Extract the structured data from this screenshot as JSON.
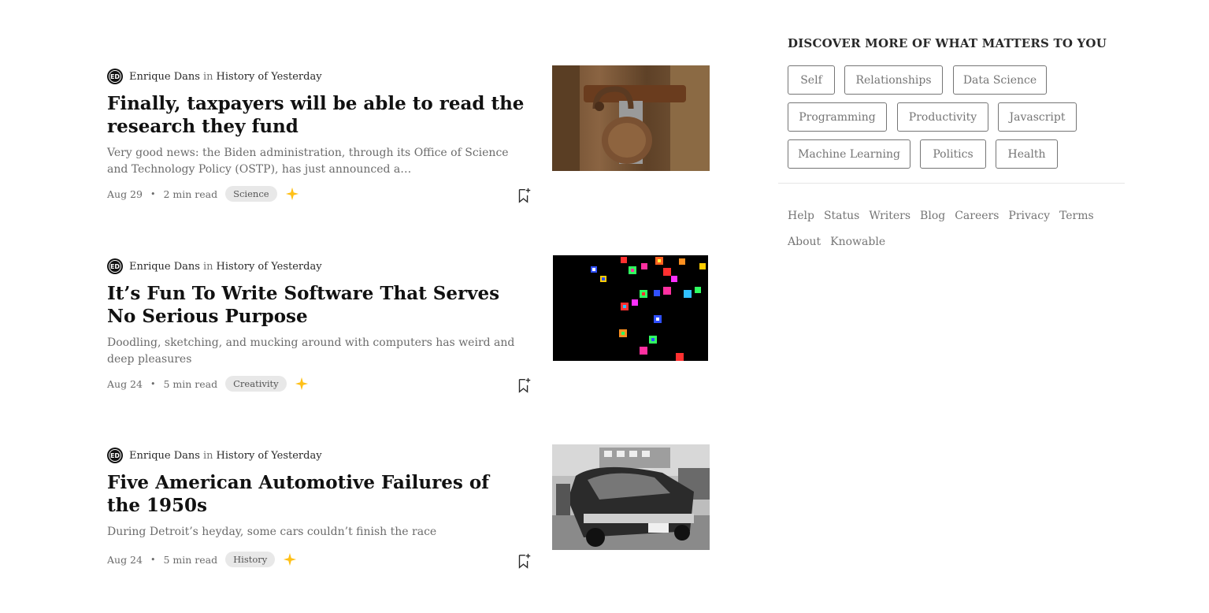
{
  "articles": [
    {
      "author": "Enrique Dans",
      "in": "in",
      "publication": "History of Yesterday",
      "title": "Finally, taxpayers will be able to read the research they fund",
      "subtitle": "Very good news: the Biden administration, through its Office of Science and Technology Policy (OSTP), has just announced a…",
      "date": "Aug 29",
      "read_time": "2 min read",
      "tag": "Science",
      "image": "rusty-padlock-photo"
    },
    {
      "author": "Enrique Dans",
      "in": "in",
      "publication": "History of Yesterday",
      "title": "It’s Fun To Write Software That Serves No Serious Purpose",
      "subtitle": "Doodling, sketching, and mucking around with computers has weird and deep pleasures",
      "date": "Aug 24",
      "read_time": "5 min read",
      "tag": "Creativity",
      "image": "pixel-art-on-black"
    },
    {
      "author": "Enrique Dans",
      "in": "in",
      "publication": "History of Yesterday",
      "title": "Five American Automotive Failures of the 1950s",
      "subtitle": "During Detroit’s heyday, some cars couldn’t finish the race",
      "date": "Aug 24",
      "read_time": "5 min read",
      "tag": "History",
      "image": "wrecked-1950s-car-photo"
    }
  ],
  "avatar_text": "ED",
  "bullet": "•",
  "sidebar": {
    "title": "DISCOVER MORE OF WHAT MATTERS TO YOU",
    "topics": [
      "Self",
      "Relationships",
      "Data Science",
      "Programming",
      "Productivity",
      "Javascript",
      "Machine Learning",
      "Politics",
      "Health"
    ],
    "footer_links": [
      "Help",
      "Status",
      "Writers",
      "Blog",
      "Careers",
      "Privacy",
      "Terms",
      "About",
      "Knowable"
    ]
  },
  "colors": {
    "star": "#FFC017",
    "text_primary": "#292929",
    "text_secondary": "#757575",
    "tag_bg": "#E8E8E8"
  },
  "icons": {
    "avatar": "author-avatar-icon",
    "member_star": "star-icon",
    "bookmark": "bookmark-add-icon"
  }
}
